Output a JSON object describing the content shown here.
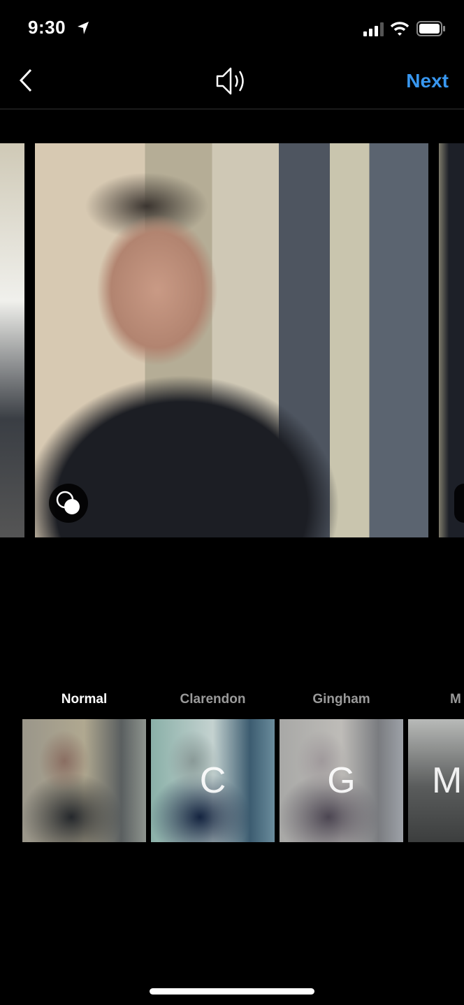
{
  "status_bar": {
    "time": "9:30",
    "icons": [
      "location-arrow-icon",
      "signal-icon",
      "wifi-icon",
      "battery-icon"
    ]
  },
  "nav": {
    "back_icon": "chevron-left-icon",
    "sound_icon": "speaker-icon",
    "next_label": "Next"
  },
  "colors": {
    "accent": "#3897f0",
    "background": "#000000"
  },
  "filters": [
    {
      "label": "Normal",
      "initial": "",
      "selected": true
    },
    {
      "label": "Clarendon",
      "initial": "C",
      "selected": false
    },
    {
      "label": "Gingham",
      "initial": "G",
      "selected": false
    },
    {
      "label": "M",
      "initial": "M",
      "selected": false
    }
  ]
}
